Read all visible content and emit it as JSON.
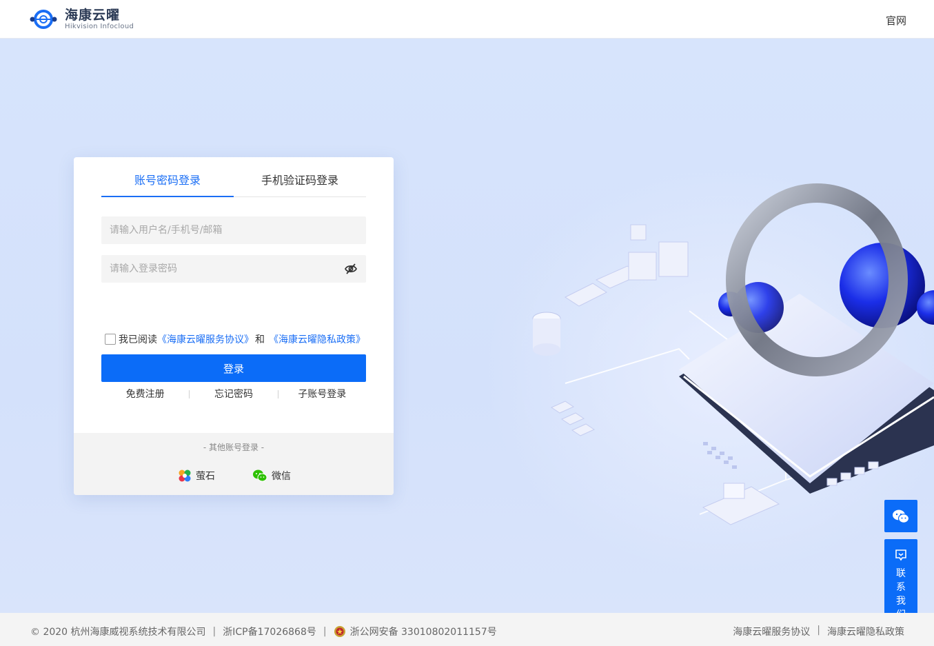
{
  "brand": {
    "name_cn": "海康云曜",
    "name_en": "Hikvision Infocloud"
  },
  "header": {
    "official_link": "官网"
  },
  "login": {
    "tabs": [
      {
        "label": "账号密码登录"
      },
      {
        "label": "手机验证码登录"
      }
    ],
    "username_placeholder": "请输入用户名/手机号/邮箱",
    "password_placeholder": "请输入登录密码",
    "agree_prefix": "我已阅读",
    "service_agreement": "《海康云曜服务协议》",
    "agree_and": "和",
    "privacy_policy": "《海康云曜隐私政策》",
    "submit": "登录",
    "links": [
      {
        "label": "免费注册"
      },
      {
        "label": "忘记密码"
      },
      {
        "label": "子账号登录"
      }
    ],
    "other_title": "- 其他账号登录 -",
    "other": [
      {
        "label": "萤石"
      },
      {
        "label": "微信"
      }
    ]
  },
  "float": {
    "contact": [
      "联",
      "系",
      "我",
      "们"
    ]
  },
  "footer": {
    "copyright": "© 2020 杭州海康威视系统技术有限公司",
    "icp": "浙ICP备17026868号",
    "police": "浙公网安备 33010802011157号",
    "service_agreement": "海康云曜服务协议",
    "privacy_policy": "海康云曜隐私政策"
  },
  "colors": {
    "primary": "#0b6cf8",
    "tab_active": "#1a6ef5",
    "background": "#d7e4fc"
  }
}
